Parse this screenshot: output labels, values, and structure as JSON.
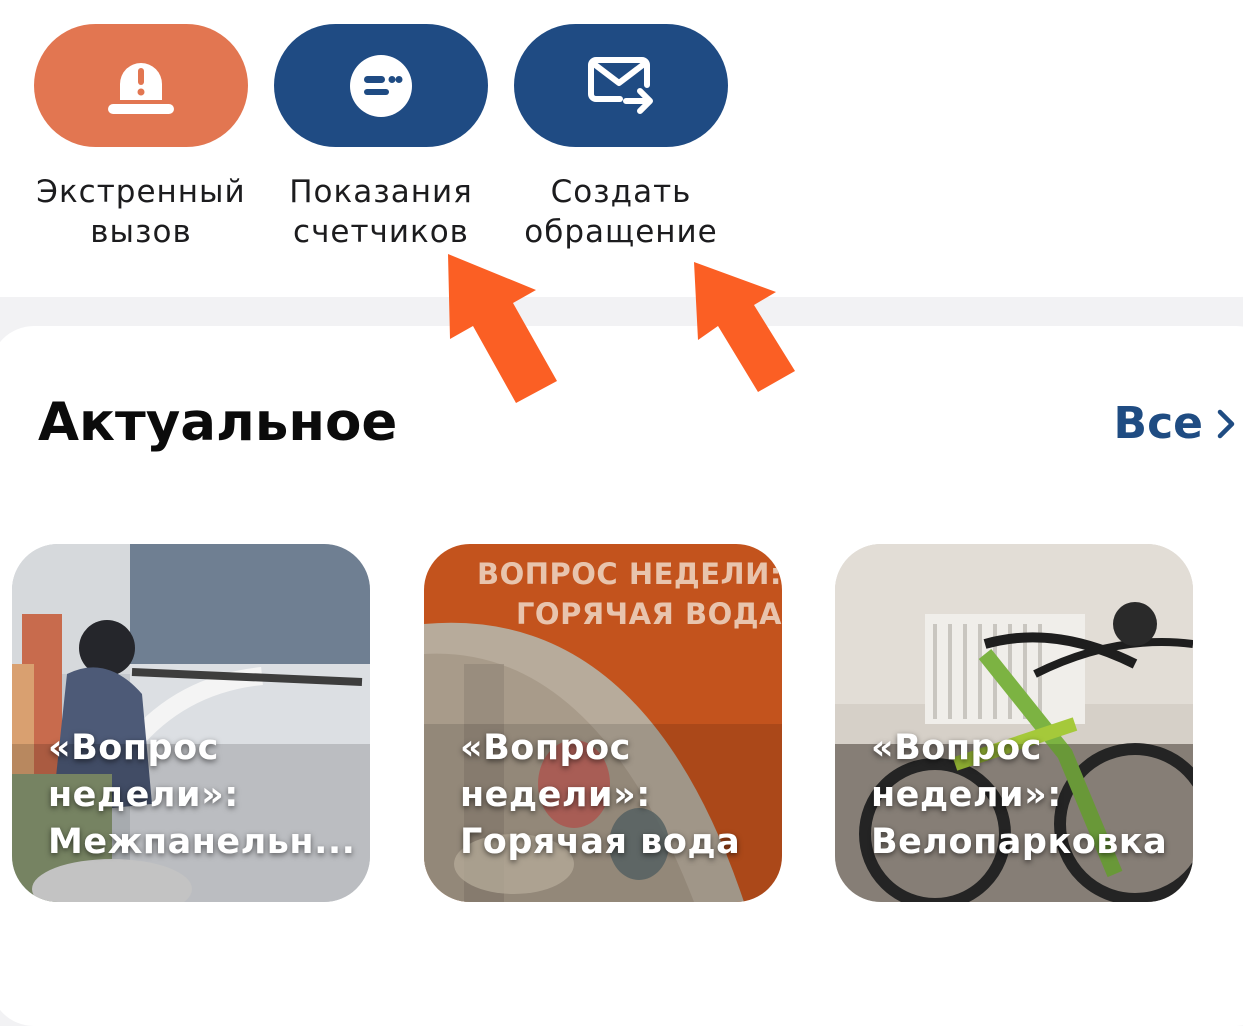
{
  "actions": [
    {
      "label": "Экстренный\nвызов",
      "icon": "emergency-siren-icon",
      "color": "#e27651"
    },
    {
      "label": "Показания\nсчетчиков",
      "icon": "meter-readings-icon",
      "color": "#1f4b83"
    },
    {
      "label": "Создать\nобращение",
      "icon": "send-mail-icon",
      "color": "#1f4b83"
    }
  ],
  "annotation_color": "#fb5f24",
  "section": {
    "title": "Актуальное",
    "see_all": "Все"
  },
  "cards": [
    {
      "title": "«Вопрос\nнедели»:\nМежпанельн..."
    },
    {
      "title": "«Вопрос\nнедели»:\nГорячая вода",
      "heading": "ВОПРОС НЕДЕЛИ:\nГОРЯЧАЯ ВОДА"
    },
    {
      "title": "«Вопрос\nнедели»:\nВелопарковка"
    }
  ]
}
